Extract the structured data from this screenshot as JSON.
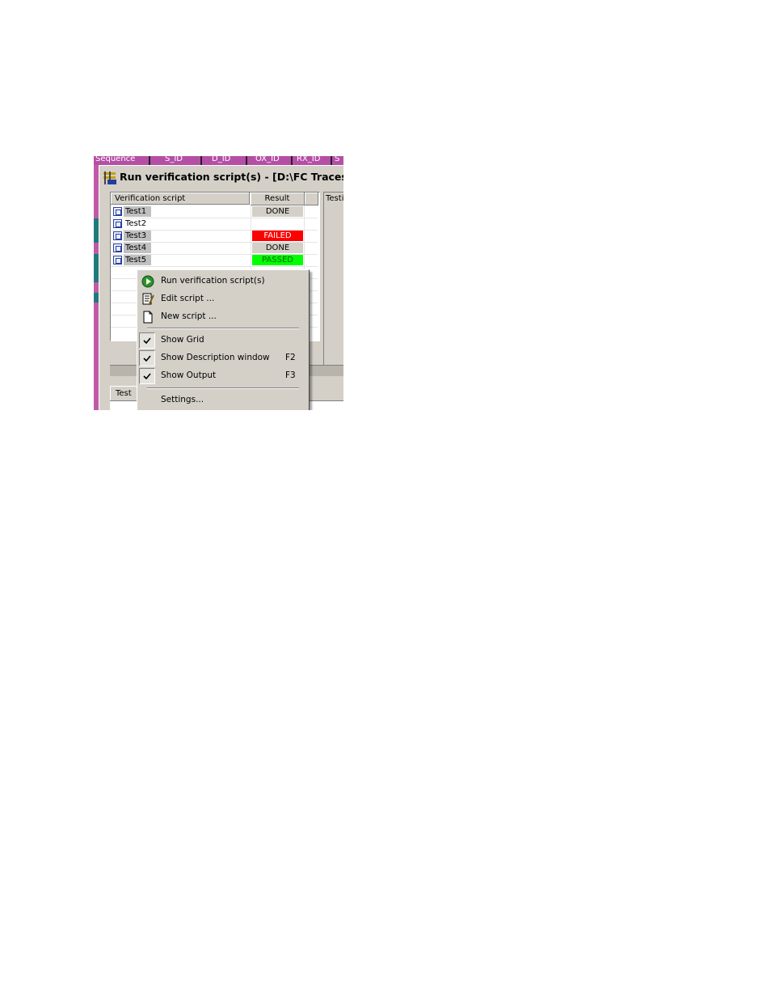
{
  "background_window": {
    "columns": [
      "Sequence",
      "S_ID",
      "D_ID",
      "OX_ID",
      "RX_ID",
      "S"
    ]
  },
  "dialog": {
    "title": "Run verification script(s) - [D:\\FC Traces\\scsi_s",
    "list": {
      "headers": {
        "script": "Verification script",
        "result": "Result"
      },
      "rows": [
        {
          "name": "Test1",
          "result": "DONE",
          "result_bg": "#d4d0c8",
          "result_fg": "#000000",
          "selected": true
        },
        {
          "name": "Test2",
          "result": "",
          "result_bg": "#ffffff",
          "result_fg": "#000000",
          "selected": false
        },
        {
          "name": "Test3",
          "result": "FAILED",
          "result_bg": "#ff0000",
          "result_fg": "#ffffff",
          "selected": true
        },
        {
          "name": "Test4",
          "result": "DONE",
          "result_bg": "#d4d0c8",
          "result_fg": "#000000",
          "selected": true
        },
        {
          "name": "Test5",
          "result": "PASSED",
          "result_bg": "#00ff00",
          "result_fg": "#006600",
          "selected": true
        }
      ]
    },
    "right_panel_label": "Testi",
    "bottom_tab": "Test"
  },
  "context_menu": {
    "items": [
      {
        "label": "Run verification script(s)",
        "icon": "run-icon"
      },
      {
        "label": "Edit script ...",
        "icon": "edit-script-icon"
      },
      {
        "label": "New script ...",
        "icon": "new-document-icon"
      },
      {
        "label": "Show Grid",
        "checked": true,
        "shortcut": ""
      },
      {
        "label": "Show Description window",
        "checked": true,
        "shortcut": "F2"
      },
      {
        "label": "Show Output",
        "checked": true,
        "shortcut": "F3"
      },
      {
        "label": "Settings..."
      }
    ]
  },
  "colors": {
    "header_purple": "#b54fa5",
    "failed_red": "#ff0000",
    "passed_green": "#00ff00",
    "window_gray": "#d4d0c8"
  }
}
